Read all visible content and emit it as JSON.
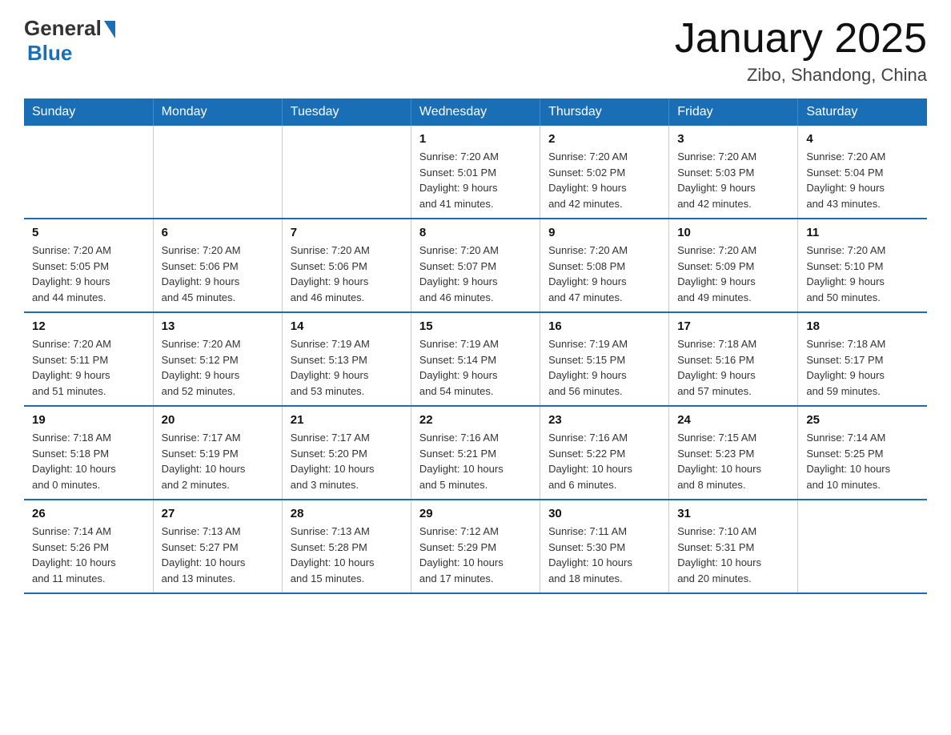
{
  "header": {
    "logo_general": "General",
    "logo_blue": "Blue",
    "title": "January 2025",
    "subtitle": "Zibo, Shandong, China"
  },
  "days_of_week": [
    "Sunday",
    "Monday",
    "Tuesday",
    "Wednesday",
    "Thursday",
    "Friday",
    "Saturday"
  ],
  "weeks": [
    [
      {
        "day": "",
        "info": ""
      },
      {
        "day": "",
        "info": ""
      },
      {
        "day": "",
        "info": ""
      },
      {
        "day": "1",
        "info": "Sunrise: 7:20 AM\nSunset: 5:01 PM\nDaylight: 9 hours\nand 41 minutes."
      },
      {
        "day": "2",
        "info": "Sunrise: 7:20 AM\nSunset: 5:02 PM\nDaylight: 9 hours\nand 42 minutes."
      },
      {
        "day": "3",
        "info": "Sunrise: 7:20 AM\nSunset: 5:03 PM\nDaylight: 9 hours\nand 42 minutes."
      },
      {
        "day": "4",
        "info": "Sunrise: 7:20 AM\nSunset: 5:04 PM\nDaylight: 9 hours\nand 43 minutes."
      }
    ],
    [
      {
        "day": "5",
        "info": "Sunrise: 7:20 AM\nSunset: 5:05 PM\nDaylight: 9 hours\nand 44 minutes."
      },
      {
        "day": "6",
        "info": "Sunrise: 7:20 AM\nSunset: 5:06 PM\nDaylight: 9 hours\nand 45 minutes."
      },
      {
        "day": "7",
        "info": "Sunrise: 7:20 AM\nSunset: 5:06 PM\nDaylight: 9 hours\nand 46 minutes."
      },
      {
        "day": "8",
        "info": "Sunrise: 7:20 AM\nSunset: 5:07 PM\nDaylight: 9 hours\nand 46 minutes."
      },
      {
        "day": "9",
        "info": "Sunrise: 7:20 AM\nSunset: 5:08 PM\nDaylight: 9 hours\nand 47 minutes."
      },
      {
        "day": "10",
        "info": "Sunrise: 7:20 AM\nSunset: 5:09 PM\nDaylight: 9 hours\nand 49 minutes."
      },
      {
        "day": "11",
        "info": "Sunrise: 7:20 AM\nSunset: 5:10 PM\nDaylight: 9 hours\nand 50 minutes."
      }
    ],
    [
      {
        "day": "12",
        "info": "Sunrise: 7:20 AM\nSunset: 5:11 PM\nDaylight: 9 hours\nand 51 minutes."
      },
      {
        "day": "13",
        "info": "Sunrise: 7:20 AM\nSunset: 5:12 PM\nDaylight: 9 hours\nand 52 minutes."
      },
      {
        "day": "14",
        "info": "Sunrise: 7:19 AM\nSunset: 5:13 PM\nDaylight: 9 hours\nand 53 minutes."
      },
      {
        "day": "15",
        "info": "Sunrise: 7:19 AM\nSunset: 5:14 PM\nDaylight: 9 hours\nand 54 minutes."
      },
      {
        "day": "16",
        "info": "Sunrise: 7:19 AM\nSunset: 5:15 PM\nDaylight: 9 hours\nand 56 minutes."
      },
      {
        "day": "17",
        "info": "Sunrise: 7:18 AM\nSunset: 5:16 PM\nDaylight: 9 hours\nand 57 minutes."
      },
      {
        "day": "18",
        "info": "Sunrise: 7:18 AM\nSunset: 5:17 PM\nDaylight: 9 hours\nand 59 minutes."
      }
    ],
    [
      {
        "day": "19",
        "info": "Sunrise: 7:18 AM\nSunset: 5:18 PM\nDaylight: 10 hours\nand 0 minutes."
      },
      {
        "day": "20",
        "info": "Sunrise: 7:17 AM\nSunset: 5:19 PM\nDaylight: 10 hours\nand 2 minutes."
      },
      {
        "day": "21",
        "info": "Sunrise: 7:17 AM\nSunset: 5:20 PM\nDaylight: 10 hours\nand 3 minutes."
      },
      {
        "day": "22",
        "info": "Sunrise: 7:16 AM\nSunset: 5:21 PM\nDaylight: 10 hours\nand 5 minutes."
      },
      {
        "day": "23",
        "info": "Sunrise: 7:16 AM\nSunset: 5:22 PM\nDaylight: 10 hours\nand 6 minutes."
      },
      {
        "day": "24",
        "info": "Sunrise: 7:15 AM\nSunset: 5:23 PM\nDaylight: 10 hours\nand 8 minutes."
      },
      {
        "day": "25",
        "info": "Sunrise: 7:14 AM\nSunset: 5:25 PM\nDaylight: 10 hours\nand 10 minutes."
      }
    ],
    [
      {
        "day": "26",
        "info": "Sunrise: 7:14 AM\nSunset: 5:26 PM\nDaylight: 10 hours\nand 11 minutes."
      },
      {
        "day": "27",
        "info": "Sunrise: 7:13 AM\nSunset: 5:27 PM\nDaylight: 10 hours\nand 13 minutes."
      },
      {
        "day": "28",
        "info": "Sunrise: 7:13 AM\nSunset: 5:28 PM\nDaylight: 10 hours\nand 15 minutes."
      },
      {
        "day": "29",
        "info": "Sunrise: 7:12 AM\nSunset: 5:29 PM\nDaylight: 10 hours\nand 17 minutes."
      },
      {
        "day": "30",
        "info": "Sunrise: 7:11 AM\nSunset: 5:30 PM\nDaylight: 10 hours\nand 18 minutes."
      },
      {
        "day": "31",
        "info": "Sunrise: 7:10 AM\nSunset: 5:31 PM\nDaylight: 10 hours\nand 20 minutes."
      },
      {
        "day": "",
        "info": ""
      }
    ]
  ]
}
